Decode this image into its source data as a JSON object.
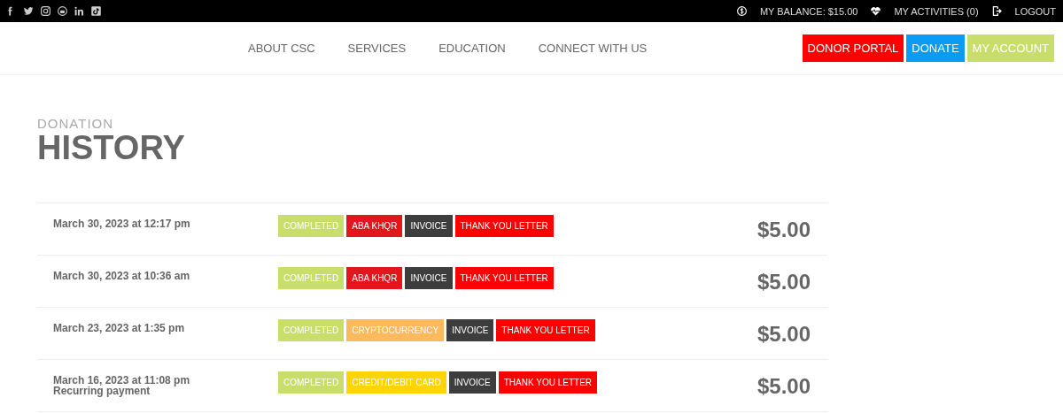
{
  "topbar": {
    "links": [
      {
        "kind": "balance",
        "label": "MY BALANCE: $15.00"
      },
      {
        "kind": "activities",
        "label": "MY ACTIVITIES (0)"
      },
      {
        "kind": "logout",
        "label": "LOGOUT"
      }
    ]
  },
  "nav": {
    "items": [
      "ABOUT CSC",
      "SERVICES",
      "EDUCATION",
      "CONNECT WITH US"
    ],
    "buttons": [
      {
        "label": "DONOR PORTAL",
        "color": "#ff0000"
      },
      {
        "label": "DONATE",
        "color": "#0a9bf5"
      },
      {
        "label": "MY ACCOUNT",
        "color": "#c8dd6a"
      }
    ]
  },
  "heading": {
    "kicker": "DONATION",
    "title": "HISTORY"
  },
  "donations": [
    {
      "date": "March 30, 2023 at 12:17 pm",
      "tags": [
        {
          "label": "COMPLETED",
          "color": "#c8dd6a"
        },
        {
          "label": "ABA KHQR",
          "color": "#e3161d"
        },
        {
          "label": "INVOICE",
          "color": "#3d3d3d"
        },
        {
          "label": "THANK YOU LETTER",
          "color": "#ff0000"
        }
      ],
      "amount": "$5.00"
    },
    {
      "date": "March 30, 2023 at 10:36 am",
      "tags": [
        {
          "label": "COMPLETED",
          "color": "#c8dd6a"
        },
        {
          "label": "ABA KHQR",
          "color": "#e3161d"
        },
        {
          "label": "INVOICE",
          "color": "#3d3d3d"
        },
        {
          "label": "THANK YOU LETTER",
          "color": "#ff0000"
        }
      ],
      "amount": "$5.00"
    },
    {
      "date": "March 23, 2023 at 1:35 pm",
      "tags": [
        {
          "label": "COMPLETED",
          "color": "#c8dd6a"
        },
        {
          "label": "CRYPTOCURRENCY",
          "color": "#fdb95e"
        },
        {
          "label": "INVOICE",
          "color": "#3d3d3d"
        },
        {
          "label": "THANK YOU LETTER",
          "color": "#ff0000"
        }
      ],
      "amount": "$5.00"
    },
    {
      "date": "March 16, 2023 at 11:08 pm",
      "note": "Recurring payment",
      "tags": [
        {
          "label": "COMPLETED",
          "color": "#c8dd6a"
        },
        {
          "label": "CREDIT/DEBIT CARD",
          "color": "#ffd400"
        },
        {
          "label": "INVOICE",
          "color": "#3d3d3d"
        },
        {
          "label": "THANK YOU LETTER",
          "color": "#ff0000"
        }
      ],
      "amount": "$5.00"
    }
  ]
}
